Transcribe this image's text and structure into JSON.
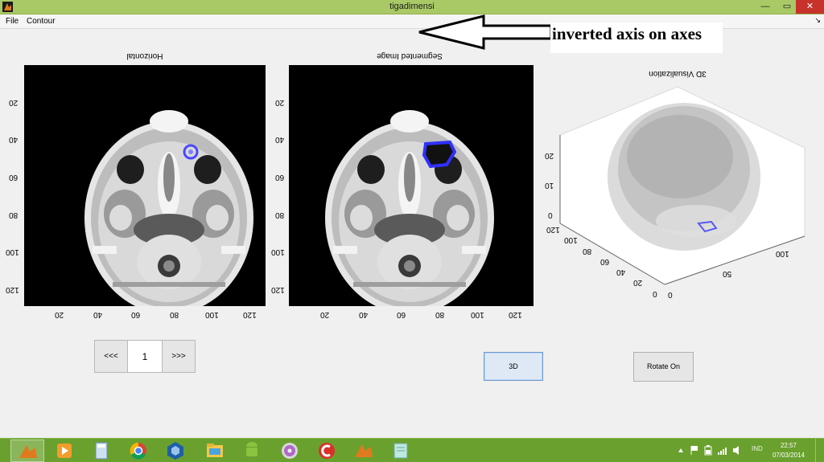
{
  "window": {
    "title": "tigadimensi",
    "minimize": "—",
    "maximize": "▭",
    "close": "✕"
  },
  "menu": {
    "items": [
      "File",
      "Contour"
    ],
    "dock_glyph": "↘"
  },
  "annotation": {
    "text": "inverted axis on axes"
  },
  "axes": [
    {
      "title": "Horizontal",
      "y_ticks": [
        "20",
        "40",
        "60",
        "80",
        "100",
        "120"
      ],
      "x_ticks": [
        "20",
        "40",
        "60",
        "80",
        "100",
        "120"
      ]
    },
    {
      "title": "Segmented Image",
      "y_ticks": [
        "20",
        "40",
        "60",
        "80",
        "100",
        "120"
      ],
      "x_ticks": [
        "20",
        "40",
        "60",
        "80",
        "100",
        "120"
      ]
    }
  ],
  "visualization": {
    "title": "3D Visualization",
    "z_ticks": [
      "0",
      "10",
      "20"
    ],
    "y_ticks": [
      "120",
      "100",
      "80",
      "60",
      "40",
      "20",
      "0"
    ],
    "x_ticks": [
      "0",
      "50",
      "100"
    ]
  },
  "controls": {
    "prev": "<<<",
    "slice": "1",
    "next": ">>>",
    "btn_3d": "3D",
    "btn_rotate": "Rotate On"
  },
  "taskbar": {
    "apps": [
      "matlab-icon",
      "media-player-icon",
      "calculator-icon",
      "chrome-icon",
      "virtualbox-icon",
      "file-explorer-icon",
      "android-icon",
      "dvd-icon",
      "ccleaner-icon",
      "matlab-icon",
      "notes-icon"
    ],
    "lang": "IND",
    "time": "22:57",
    "date": "07/03/2014"
  },
  "colors": {
    "titlebar": "#a9c966",
    "taskbar": "#6aa02e",
    "contour": "#3a3aff",
    "close": "#c7332b"
  }
}
